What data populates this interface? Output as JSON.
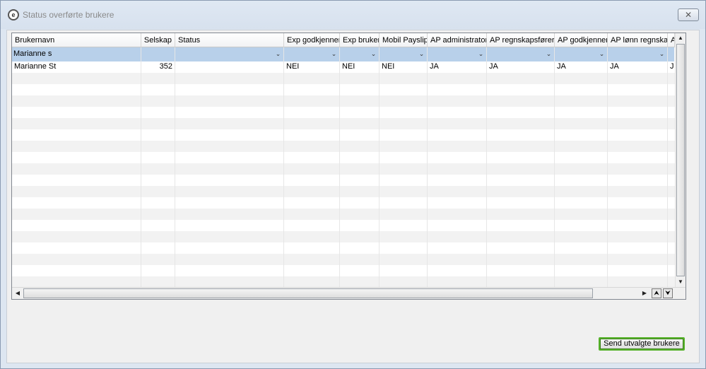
{
  "window": {
    "title": "Status overførte brukere",
    "close_symbol": "✕"
  },
  "grid": {
    "columns": [
      {
        "label": "Brukernavn",
        "align": "left"
      },
      {
        "label": "Selskap",
        "align": "right"
      },
      {
        "label": "Status",
        "align": "left"
      },
      {
        "label": "Exp godkjenner",
        "align": "left"
      },
      {
        "label": "Exp bruker",
        "align": "left"
      },
      {
        "label": "Mobil Payslip",
        "align": "left"
      },
      {
        "label": "AP administrator",
        "align": "left"
      },
      {
        "label": "AP regnskapsfører",
        "align": "left"
      },
      {
        "label": "AP godkjenner",
        "align": "left"
      },
      {
        "label": "AP lønn regnskap",
        "align": "left"
      },
      {
        "label": "A",
        "align": "left"
      }
    ],
    "filter_row": {
      "brukernavn_value": "Marianne s"
    },
    "rows": [
      {
        "brukernavn": "Marianne St",
        "selskap": "352",
        "status": "",
        "exp_godkjenner": "NEI",
        "exp_bruker": "NEI",
        "mobil_payslip": "NEI",
        "ap_administrator": "JA",
        "ap_regnskapsforer": "JA",
        "ap_godkjenner": "JA",
        "ap_lonn_regnskap": "JA",
        "extra": "J"
      }
    ]
  },
  "actions": {
    "send_label": "Send utvalgte brukere"
  },
  "colors": {
    "filter_row": "#b8d0ea",
    "send_button_border": "#58b32d"
  }
}
